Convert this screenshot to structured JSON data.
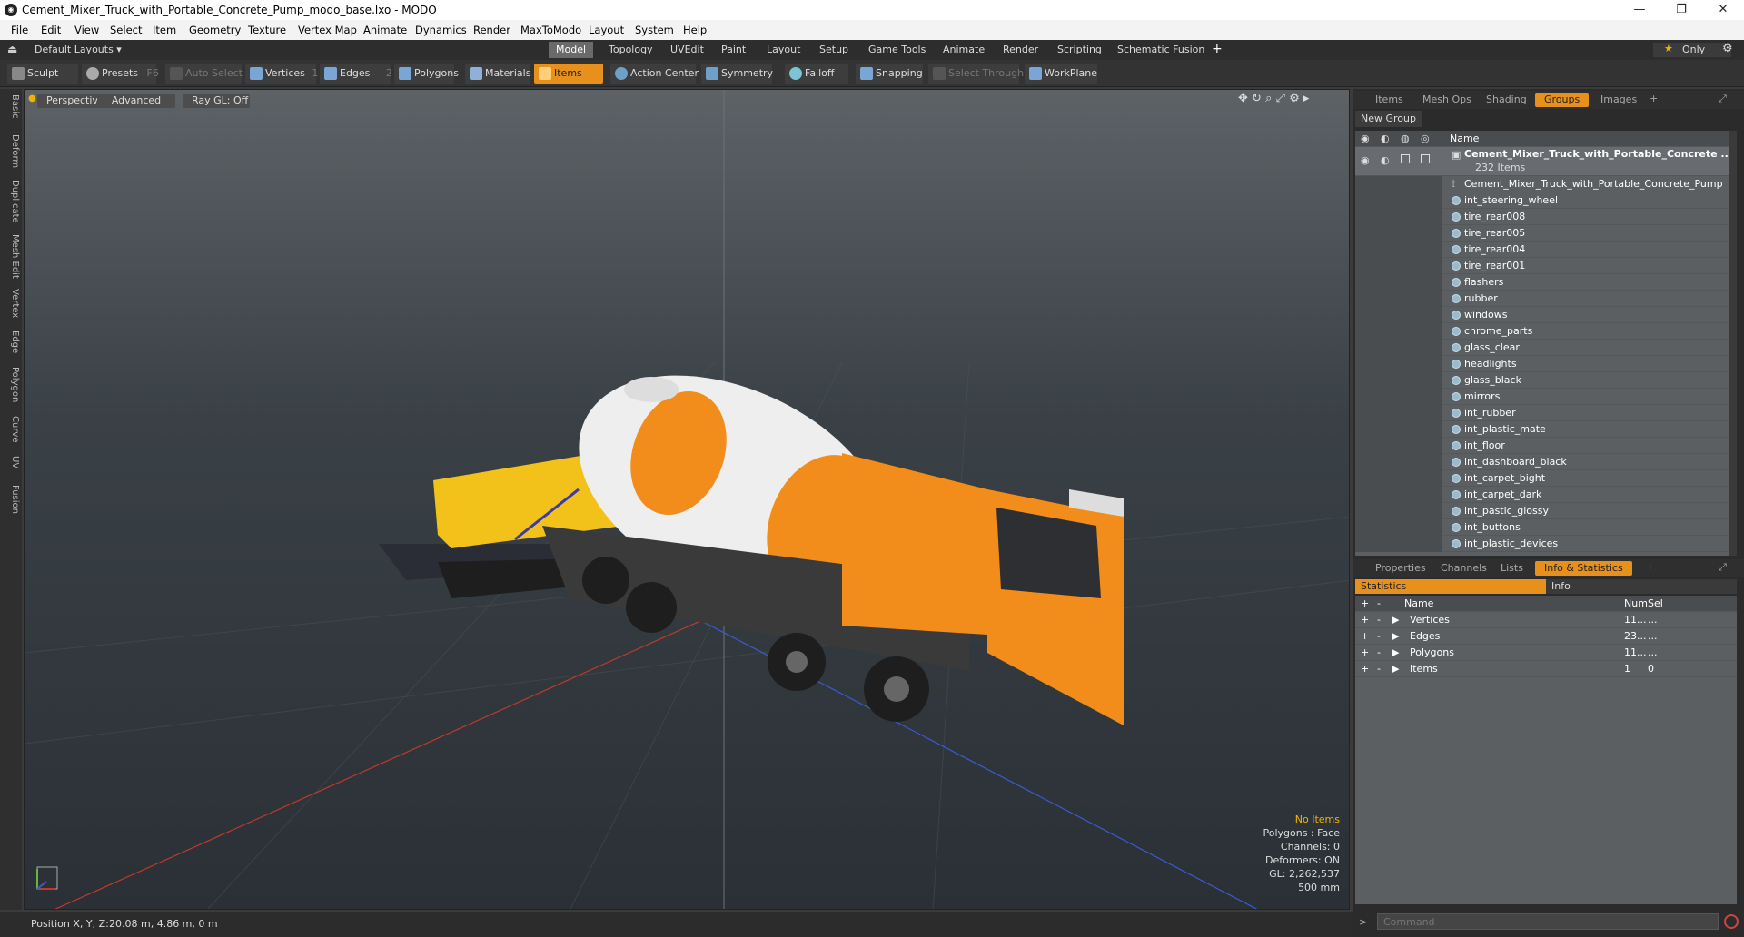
{
  "window": {
    "title": "Cement_Mixer_Truck_with_Portable_Concrete_Pump_modo_base.lxo - MODO",
    "minimize": "—",
    "maximize": "❐",
    "close": "✕"
  },
  "menu": [
    "File",
    "Edit",
    "View",
    "Select",
    "Item",
    "Geometry",
    "Texture",
    "Vertex Map",
    "Animate",
    "Dynamics",
    "Render",
    "MaxToModo",
    "Layout",
    "System",
    "Help"
  ],
  "layout": {
    "name": "Default Layouts ▾",
    "tabs": [
      "Model",
      "Topology",
      "UVEdit",
      "Paint",
      "Layout",
      "Setup",
      "Game Tools",
      "Animate",
      "Render",
      "Scripting",
      "Schematic Fusion"
    ],
    "active_tab": "Model",
    "add": "+",
    "only_label": "Only",
    "star": "★"
  },
  "toolbar": {
    "sculpt": "Sculpt",
    "presets": "Presets",
    "presets_key": "F6",
    "auto_select": "Auto Select",
    "vertices": "Vertices",
    "vertices_count": "1",
    "edges": "Edges",
    "edges_count": "2",
    "polygons": "Polygons",
    "materials": "Materials",
    "items": "Items",
    "action_center": "Action Center",
    "symmetry": "Symmetry",
    "falloff": "Falloff",
    "snapping": "Snapping",
    "select_through": "Select Through",
    "workplane": "WorkPlane"
  },
  "left_tabs": [
    "Basic",
    "Deform",
    "Duplicate",
    "Mesh Edit",
    "Vertex",
    "Edge",
    "Polygon",
    "Curve",
    "UV",
    "Fusion"
  ],
  "viewport": {
    "view": "Perspective",
    "shading": "Advanced",
    "raygl": "Ray GL: Off",
    "hud": {
      "selection": "No Items",
      "polygons": "Polygons : Face",
      "channels": "Channels: 0",
      "deformers": "Deformers: ON",
      "gl": "GL: 2,262,537",
      "grid": "500 mm"
    },
    "colors": {
      "truck": "#f28c1a",
      "drum_white": "#eeeeee",
      "pump": "#f2c21a",
      "axis_x": "#c0392b",
      "axis_z": "#3a5bd0"
    }
  },
  "status": {
    "position_label": "Position X, Y, Z:",
    "position_value": "20.08 m, 4.86 m, 0 m"
  },
  "right_top": {
    "tabs": [
      "Items",
      "Mesh Ops",
      "Shading",
      "Groups",
      "Images"
    ],
    "active": "Groups",
    "add": "+",
    "new_group": "New Group",
    "col_name": "Name",
    "group_name": "Cement_Mixer_Truck_with_Portable_Concrete ...",
    "group_count": "232 Items",
    "items": [
      "Cement_Mixer_Truck_with_Portable_Concrete_Pump",
      "int_steering_wheel",
      "tire_rear008",
      "tire_rear005",
      "tire_rear004",
      "tire_rear001",
      "flashers",
      "rubber",
      "windows",
      "chrome_parts",
      "glass_clear",
      "headlights",
      "glass_black",
      "mirrors",
      "int_rubber",
      "int_plastic_mate",
      "int_floor",
      "int_dashboard_black",
      "int_carpet_bight",
      "int_carpet_dark",
      "int_pastic_glossy",
      "int_buttons",
      "int_plastic_devices"
    ]
  },
  "right_bottom": {
    "tabs": [
      "Properties",
      "Channels",
      "Lists",
      "Info & Statistics"
    ],
    "active": "Info & Statistics",
    "add": "+",
    "sub_tabs": [
      "Statistics",
      "Info"
    ],
    "columns": {
      "name": "Name",
      "num": "Num",
      "sel": "Sel"
    },
    "rows": [
      {
        "name": "Vertices",
        "num": "11...",
        "sel": "..."
      },
      {
        "name": "Edges",
        "num": "23...",
        "sel": "..."
      },
      {
        "name": "Polygons",
        "num": "11...",
        "sel": "..."
      },
      {
        "name": "Items",
        "num": "1",
        "sel": "0"
      }
    ]
  },
  "command": {
    "placeholder": "Command",
    "prompt": ">"
  }
}
